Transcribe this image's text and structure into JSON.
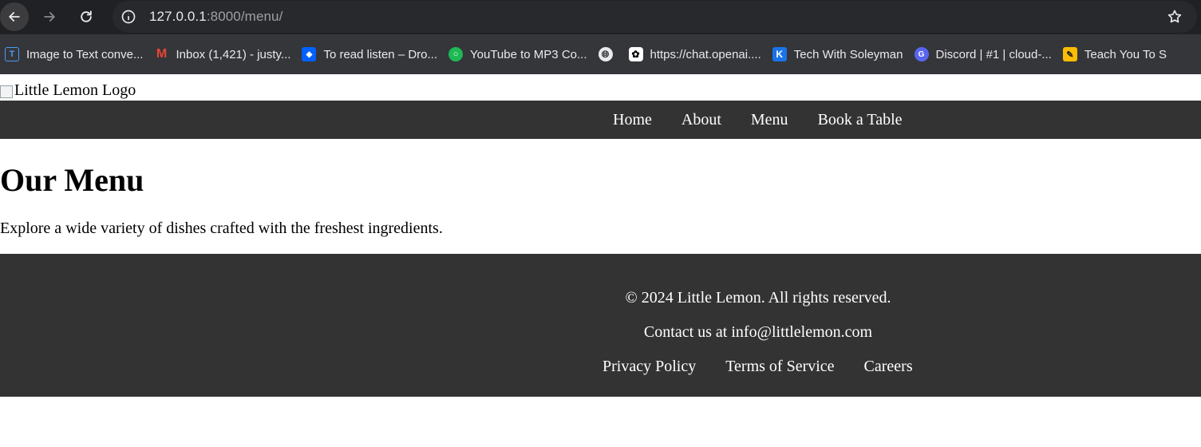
{
  "browser": {
    "url_host": "127.0.0.1",
    "url_path": ":8000/menu/",
    "bookmarks": [
      {
        "label": "Image to Text conve...",
        "icon": "text-scan-icon",
        "color": "#1a73e8"
      },
      {
        "label": "Inbox (1,421) - justy...",
        "icon": "gmail-icon",
        "color": "#ea4335"
      },
      {
        "label": "To read listen – Dro...",
        "icon": "dropbox-icon",
        "color": "#0061fe"
      },
      {
        "label": "YouTube to MP3 Co...",
        "icon": "converter-icon",
        "color": "#1db954"
      },
      {
        "label": "",
        "icon": "globe-icon",
        "color": "#e8eaed"
      },
      {
        "label": "https://chat.openai....",
        "icon": "openai-icon",
        "color": "#ffffff"
      },
      {
        "label": "Tech With Soleyman",
        "icon": "k-badge-icon",
        "color": "#1a73e8"
      },
      {
        "label": "Discord | #1 | cloud-...",
        "icon": "discord-icon",
        "color": "#5865f2"
      },
      {
        "label": "Teach You To S",
        "icon": "teacher-icon",
        "color": "#fbbc04"
      }
    ]
  },
  "site": {
    "logo_alt": "Little Lemon Logo",
    "nav": [
      "Home",
      "About",
      "Menu",
      "Book a Table"
    ],
    "title": "Our Menu",
    "description": "Explore a wide variety of dishes crafted with the freshest ingredients.",
    "footer": {
      "copyright": "© 2024 Little Lemon. All rights reserved.",
      "contact": "Contact us at info@littlelemon.com",
      "links": [
        "Privacy Policy",
        "Terms of Service",
        "Careers"
      ]
    }
  },
  "colors": {
    "nav_background": "#333333",
    "footer_background": "#333333",
    "browser_background": "#202124"
  }
}
